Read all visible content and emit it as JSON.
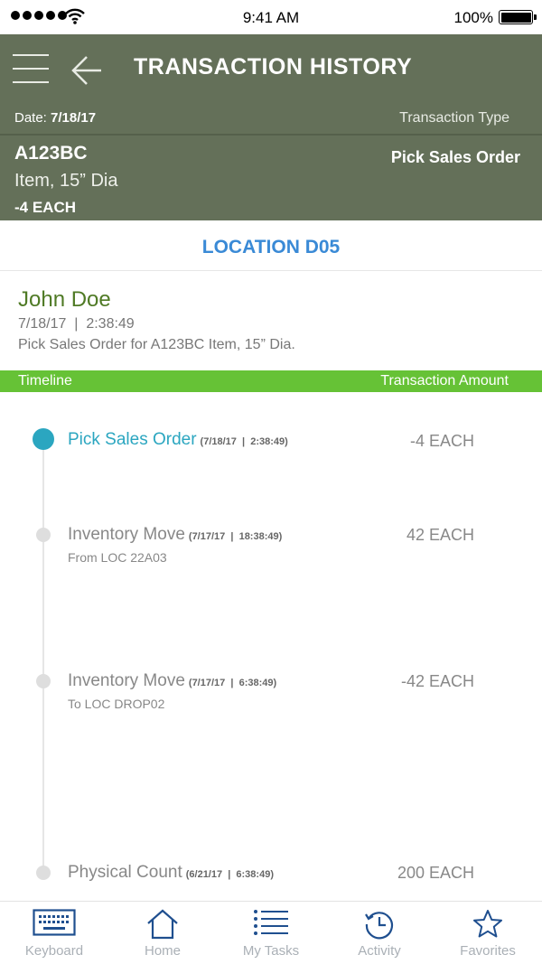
{
  "status_bar": {
    "time": "9:41 AM",
    "battery": "100%"
  },
  "header": {
    "title": "TRANSACTION HISTORY",
    "date_label": "Date: ",
    "date_value": "7/18/17",
    "type_label": "Transaction Type",
    "item_code": "A123BC",
    "item_desc": "Item, 15” Dia",
    "quantity": "-4 EACH",
    "type_value": "Pick Sales Order"
  },
  "location": "LOCATION D05",
  "detail": {
    "user": "John Doe",
    "when": "7/18/17  |  2:38:49",
    "note": "Pick Sales Order for A123BC Item, 15” Dia."
  },
  "columns": {
    "left": "Timeline",
    "right": "Transaction Amount"
  },
  "timeline": [
    {
      "label": "Pick Sales Order",
      "stamp": "(7/18/17  |  2:38:49)",
      "sub": "",
      "amount": "-4 EACH",
      "active": true
    },
    {
      "label": "Inventory Move",
      "stamp": "(7/17/17  |  18:38:49)",
      "sub": "From LOC 22A03",
      "amount": "42 EACH",
      "active": false
    },
    {
      "label": "Inventory Move",
      "stamp": "(7/17/17  |  6:38:49)",
      "sub": "To LOC DROP02",
      "amount": "-42 EACH",
      "active": false
    },
    {
      "label": "Physical Count",
      "stamp": "(6/21/17  |  6:38:49)",
      "sub": "",
      "amount": "200 EACH",
      "active": false
    }
  ],
  "nav": [
    {
      "label": "Keyboard",
      "icon": "keyboard-icon"
    },
    {
      "label": "Home",
      "icon": "home-icon"
    },
    {
      "label": "My Tasks",
      "icon": "list-icon"
    },
    {
      "label": "Activity",
      "icon": "history-icon"
    },
    {
      "label": "Favorites",
      "icon": "star-icon"
    }
  ],
  "colors": {
    "header": "#647059",
    "accent_blue": "#3a8ad6",
    "timeline_active": "#2ba6c0",
    "green_bar": "#66c236",
    "user_name": "#4f7a25",
    "nav_icon": "#1f4f8f"
  }
}
